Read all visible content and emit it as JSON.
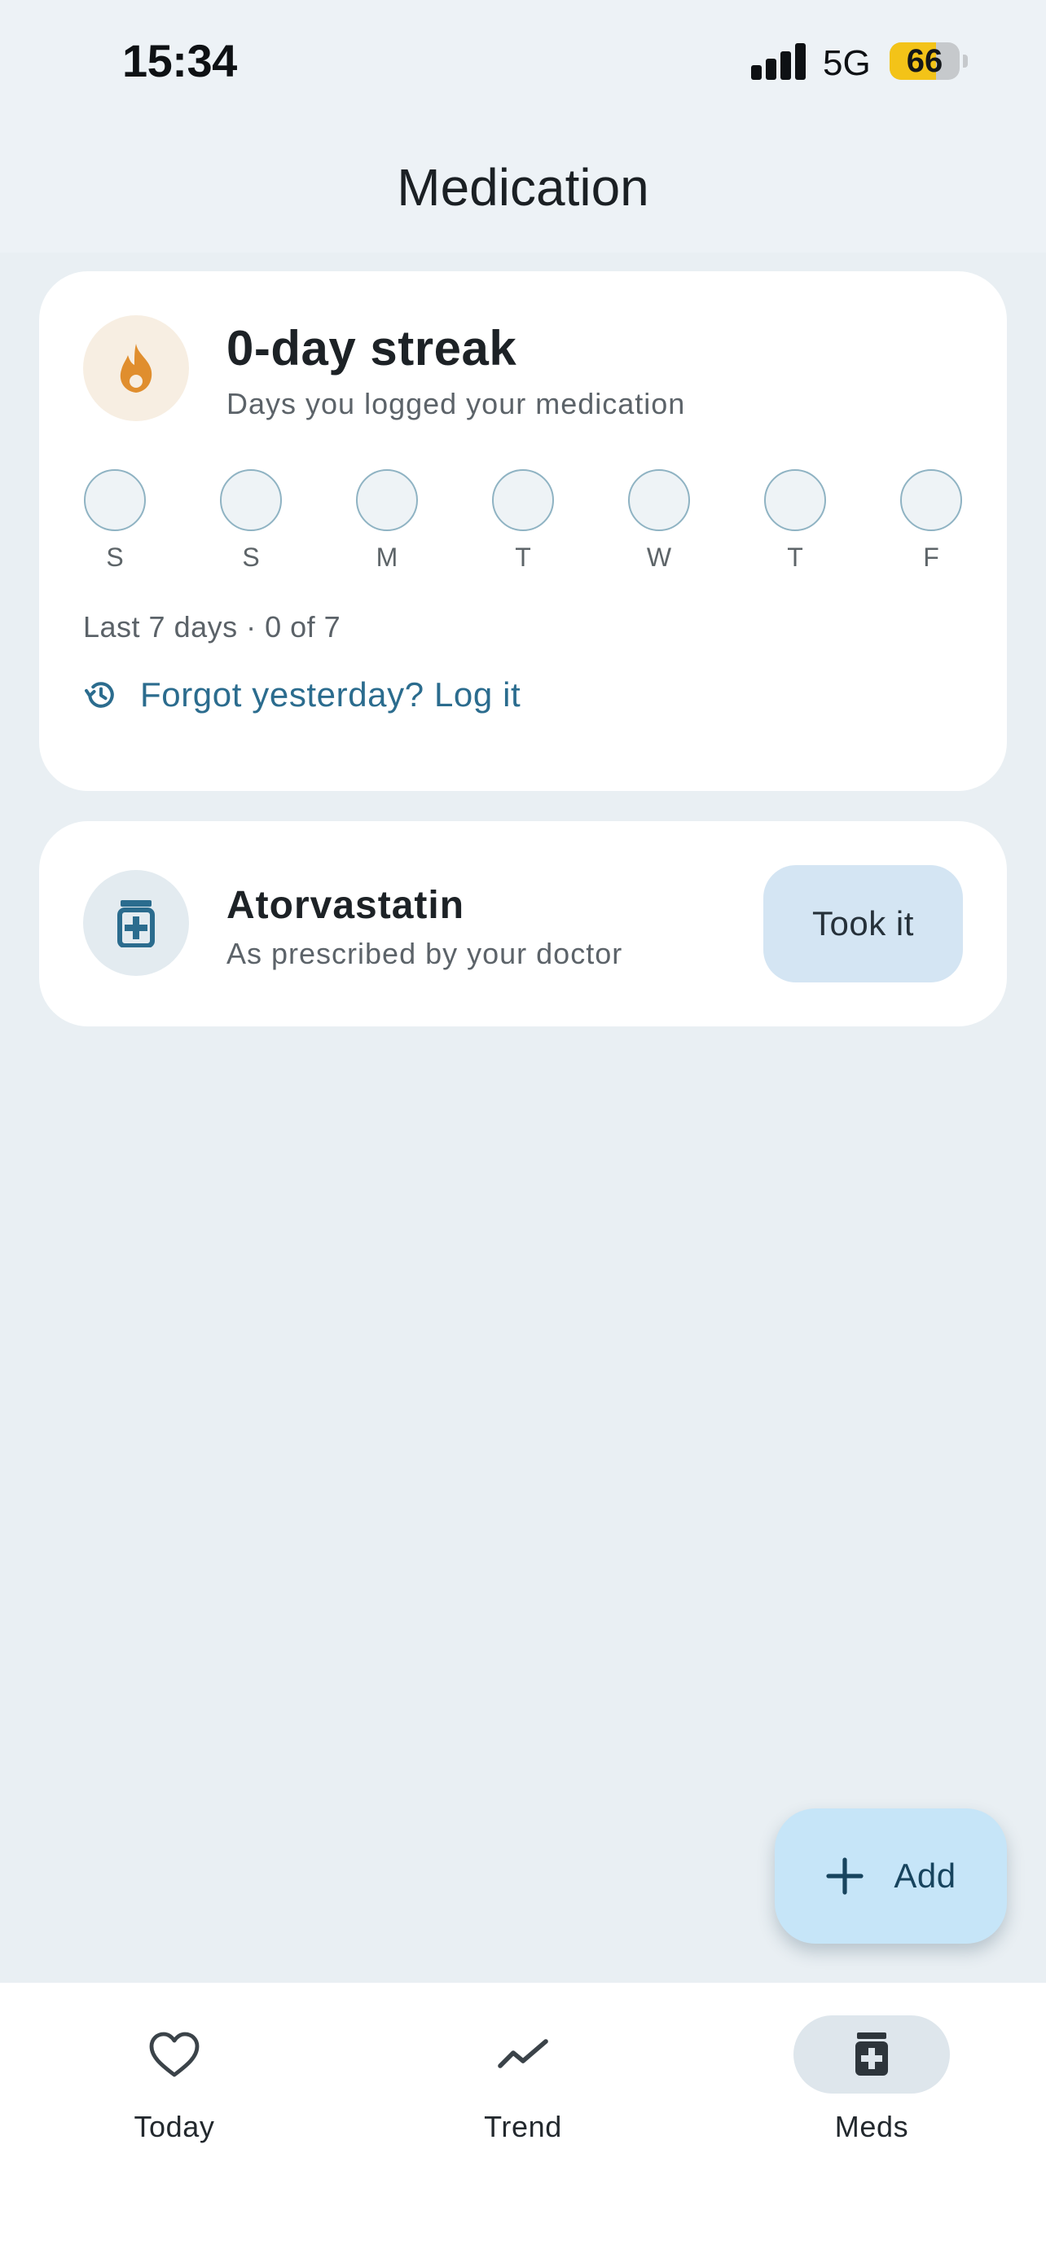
{
  "status_bar": {
    "time": "15:34",
    "network": "5G",
    "battery_percent": 66,
    "battery_label": "66"
  },
  "header": {
    "title": "Medication"
  },
  "streak_card": {
    "title": "0-day streak",
    "subtitle": "Days you logged your medication",
    "days": [
      {
        "label": "S",
        "logged": false
      },
      {
        "label": "S",
        "logged": false
      },
      {
        "label": "M",
        "logged": false
      },
      {
        "label": "T",
        "logged": false
      },
      {
        "label": "W",
        "logged": false
      },
      {
        "label": "T",
        "logged": false
      },
      {
        "label": "F",
        "logged": false
      }
    ],
    "summary": "Last 7 days · 0 of 7",
    "log_link_label": "Forgot yesterday? Log it"
  },
  "medication": {
    "name": "Atorvastatin",
    "subtitle": "As prescribed by your doctor",
    "action_label": "Took it"
  },
  "fab": {
    "label": "Add",
    "icon": "plus-icon"
  },
  "bottom_nav": {
    "items": [
      {
        "label": "Today",
        "icon": "heart-icon",
        "active": false
      },
      {
        "label": "Trend",
        "icon": "trend-icon",
        "active": false
      },
      {
        "label": "Meds",
        "icon": "pill-bottle-icon",
        "active": true
      }
    ]
  },
  "colors": {
    "background": "#e9eff3",
    "card": "#ffffff",
    "accent": "#2b6c8e",
    "flame": "#e08e2e",
    "battery": "#f3c318",
    "took_button": "#d4e5f3",
    "fab": "#c6e5f8"
  }
}
